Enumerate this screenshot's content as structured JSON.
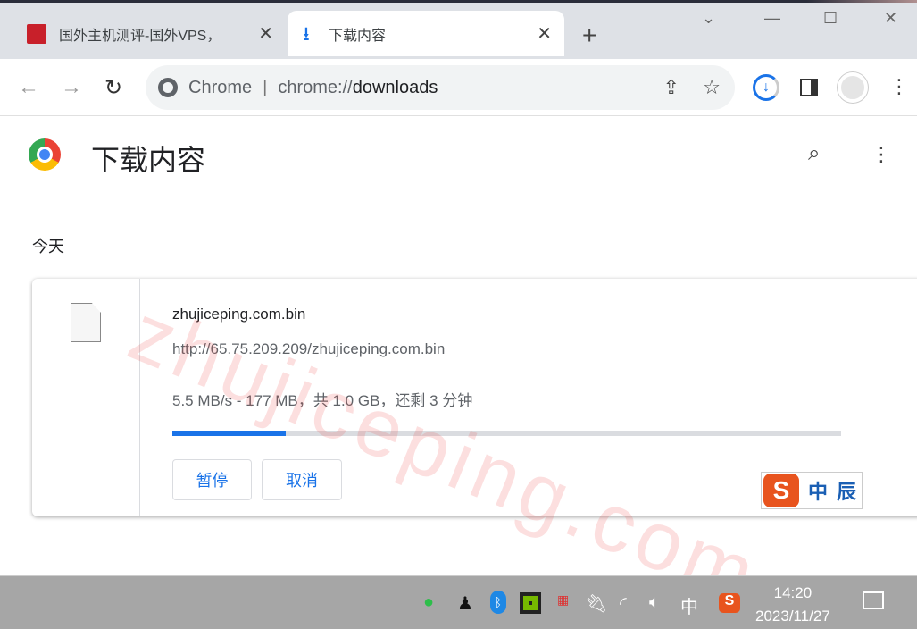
{
  "tabs": [
    {
      "title": "国外主机测评-国外VPS，",
      "icon": "site-favicon"
    },
    {
      "title": "下载内容",
      "icon": "download-icon",
      "active": true
    }
  ],
  "omnibox": {
    "scheme_label": "Chrome",
    "url_prefix": "chrome://",
    "url_main": "downloads"
  },
  "page": {
    "title": "下载内容",
    "section": "今天"
  },
  "download": {
    "filename": "zhujiceping.com.bin",
    "url": "http://65.75.209.209/zhujiceping.com.bin",
    "status": "5.5 MB/s - 177 MB，共 1.0 GB，还剩 3 分钟",
    "progress_percent": 17,
    "pause_label": "暂停",
    "cancel_label": "取消"
  },
  "watermark": "zhujiceping.com",
  "ime": {
    "mode": "中",
    "icon": "sogou-icon"
  },
  "taskbar": {
    "time": "14:20",
    "date": "2023/11/27",
    "ime": "中"
  },
  "colors": {
    "accent": "#1a73e8",
    "taskbar": "#a6a6a6"
  }
}
